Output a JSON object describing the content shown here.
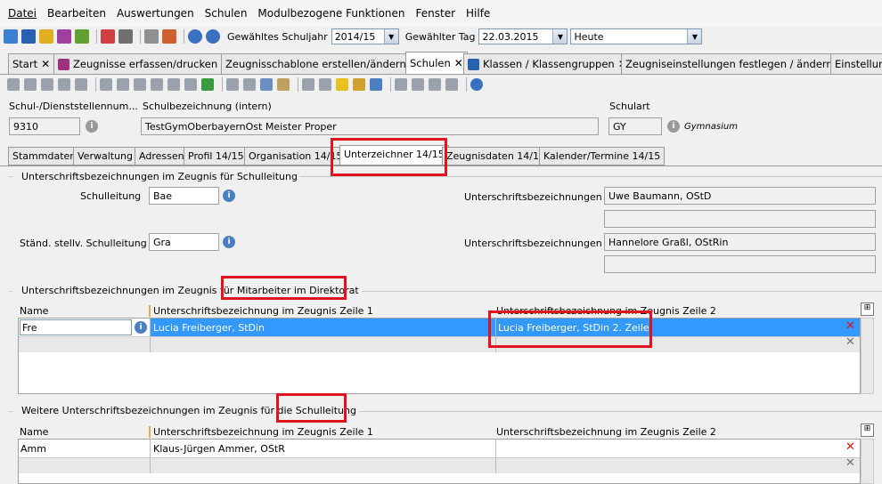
{
  "menu": [
    "Datei",
    "Bearbeiten",
    "Auswertungen",
    "Schulen",
    "Modulbezogene Funktionen",
    "Fenster",
    "Hilfe"
  ],
  "toolbar": {
    "schuljahr_label": "Gewähltes Schuljahr",
    "schuljahr": "2014/15",
    "tag_label": "Gewählter Tag",
    "tag": "22.03.2015",
    "heute": "Heute"
  },
  "tabs": [
    "Start",
    "Zeugnisse erfassen/drucken",
    "Zeugnisschablone erstellen/ändern",
    "Schulen",
    "Klassen / Klassengruppen",
    "Zeugniseinstellungen festlegen / ändern",
    "Einstellun"
  ],
  "school": {
    "nr_label": "Schul-/Dienststellennum...",
    "nr": "9310",
    "name_label": "Schulbezeichnung (intern)",
    "name": "TestGymOberbayernOst Meister Proper",
    "art_label": "Schulart",
    "art": "GY",
    "art_text": "Gymnasium"
  },
  "subtabs": [
    "Stammdaten",
    "Verwaltung",
    "Adressen",
    "Profil 14/15",
    "Organisation 14/15",
    "Unterzeichner 14/15",
    "Zeugnisdaten 14/15",
    "Kalender/Termine 14/15"
  ],
  "sec1": {
    "title": "Unterschriftsbezeichnungen im Zeugnis für Schulleitung",
    "sl_label": "Schulleitung",
    "sl": "Bae",
    "ub_label": "Unterschriftsbezeichnungen",
    "sl_name": "Uwe Baumann, OStD",
    "stv_label": "Ständ. stellv. Schulleitung",
    "stv": "Gra",
    "stv_name": "Hannelore Graßl, OStRin"
  },
  "sec2": {
    "title": "Unterschriftsbezeichnungen im Zeugnis für Mitarbeiter im Direktorat",
    "cols": [
      "Name",
      "Unterschriftsbezeichnung im Zeugnis Zeile 1",
      "Unterschriftsbezeichnung im Zeugnis Zeile 2"
    ],
    "row": {
      "name": "Fre",
      "z1": "Lucia Freiberger, StDin",
      "z2": "Lucia Freiberger, StDin 2. Zeile"
    }
  },
  "sec3": {
    "title": "Weitere Unterschriftsbezeichnungen im Zeugnis für die Schulleitung",
    "cols": [
      "Name",
      "Unterschriftsbezeichnung im Zeugnis Zeile 1",
      "Unterschriftsbezeichnung im Zeugnis Zeile 2"
    ],
    "row": {
      "name": "Amm",
      "z1": "Klaus-Jürgen Ammer, OStR",
      "z2": ""
    }
  }
}
